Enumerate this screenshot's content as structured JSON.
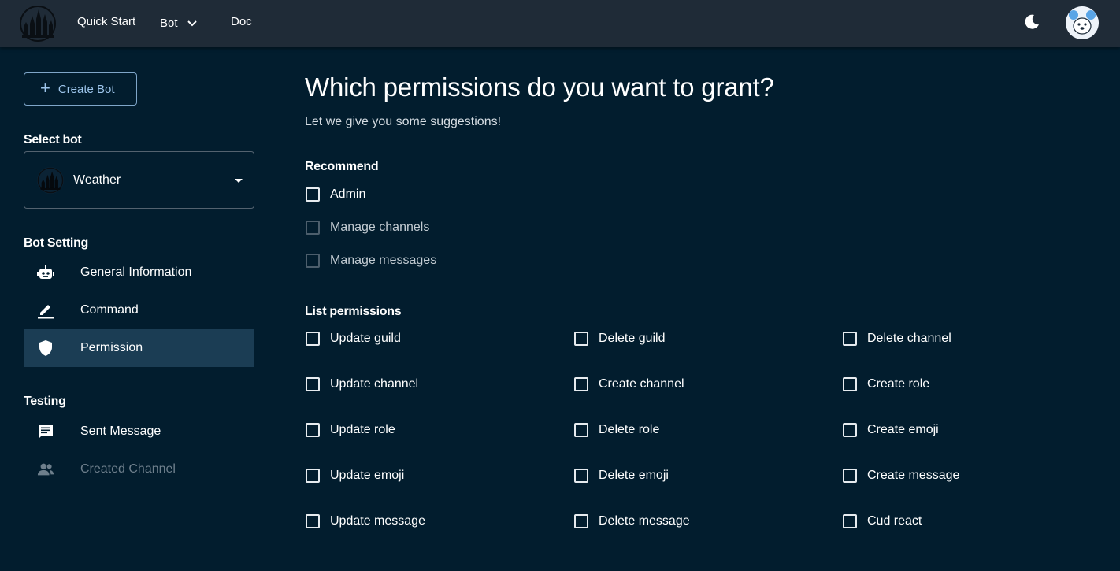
{
  "header": {
    "nav": {
      "quick_start": "Quick Start",
      "bot": "Bot",
      "doc": "Doc"
    }
  },
  "sidebar": {
    "create_bot": "Create Bot",
    "select_bot_label": "Select bot",
    "selected_bot": "Weather",
    "bot_setting_label": "Bot Setting",
    "settings_items": [
      {
        "label": "General Information",
        "icon": "robot-icon"
      },
      {
        "label": "Command",
        "icon": "pencil-icon"
      },
      {
        "label": "Permission",
        "icon": "shield-icon",
        "active": true
      }
    ],
    "testing_label": "Testing",
    "testing_items": [
      {
        "label": "Sent Message",
        "icon": "message-icon"
      },
      {
        "label": "Created Channel",
        "icon": "people-icon",
        "disabled": true
      }
    ]
  },
  "main": {
    "title": "Which permissions do you want to grant?",
    "subtitle": "Let we give you some suggestions!",
    "recommend_label": "Recommend",
    "recommend": [
      {
        "label": "Admin",
        "checked": false
      },
      {
        "label": "Manage channels",
        "checked": false,
        "disabled": true
      },
      {
        "label": "Manage messages",
        "checked": false,
        "disabled": true
      }
    ],
    "list_label": "List permissions",
    "permissions": [
      "Update guild",
      "Delete guild",
      "Delete channel",
      "Update channel",
      "Create channel",
      "Create role",
      "Update role",
      "Delete role",
      "Create emoji",
      "Update emoji",
      "Delete emoji",
      "Create message",
      "Update message",
      "Delete message",
      "Cud react"
    ]
  },
  "colors": {
    "background": "#021d2e",
    "topbar": "#1f2b37",
    "active_item": "#1b3d54",
    "accent": "#9ec6ec"
  }
}
